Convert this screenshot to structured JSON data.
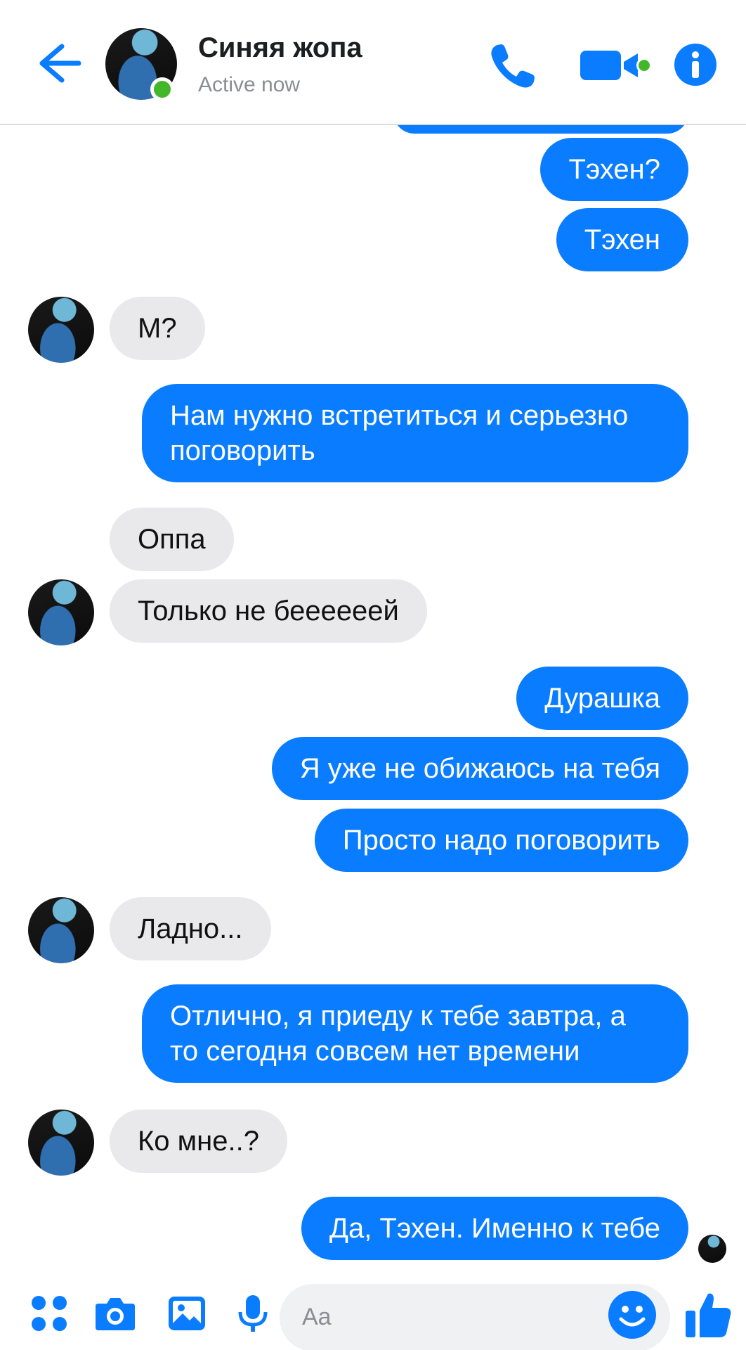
{
  "header": {
    "contact_name": "Синяя жопа",
    "status": "Active now",
    "icons": [
      "back-arrow-icon",
      "phone-icon",
      "video-camera-icon",
      "info-icon"
    ]
  },
  "messages": [
    {
      "dir": "out",
      "text": "Тэхен?"
    },
    {
      "dir": "out",
      "text": "Тэхен"
    },
    {
      "dir": "in",
      "text": "М?"
    },
    {
      "dir": "out",
      "text": "Нам нужно встретиться и серьезно поговорить"
    },
    {
      "dir": "in",
      "text": "Оппа"
    },
    {
      "dir": "in",
      "text": "Только не беееееей"
    },
    {
      "dir": "out",
      "text": "Дурашка"
    },
    {
      "dir": "out",
      "text": "Я уже не обижаюсь на тебя"
    },
    {
      "dir": "out",
      "text": "Просто надо поговорить"
    },
    {
      "dir": "in",
      "text": "Ладно..."
    },
    {
      "dir": "out",
      "text": "Отлично, я приеду к тебе завтра, а то сегодня совсем нет времени"
    },
    {
      "dir": "in",
      "text": "Ко мне..?"
    },
    {
      "dir": "out",
      "text": "Да, Тэхен. Именно к тебе"
    }
  ],
  "composer": {
    "placeholder": "Aa",
    "icons": [
      "apps-icon",
      "camera-icon",
      "gallery-icon",
      "microphone-icon",
      "emoji-icon",
      "thumbs-up-icon"
    ]
  },
  "colors": {
    "accent": "#0a7cff",
    "incoming_bubble": "#e9e9eb",
    "online": "#42b72a"
  }
}
